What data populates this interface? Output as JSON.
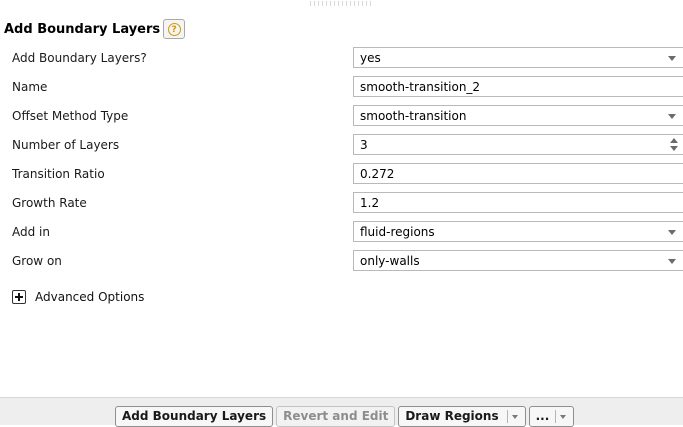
{
  "panel": {
    "title": "Add Boundary Layers",
    "help_glyph": "?"
  },
  "form": {
    "add_boundary_layers": {
      "label": "Add Boundary Layers?",
      "value": "yes"
    },
    "name": {
      "label": "Name",
      "value": "smooth-transition_2"
    },
    "offset_method": {
      "label": "Offset Method Type",
      "value": "smooth-transition"
    },
    "num_layers": {
      "label": "Number of Layers",
      "value": "3"
    },
    "transition_ratio": {
      "label": "Transition Ratio",
      "value": "0.272"
    },
    "growth_rate": {
      "label": "Growth Rate",
      "value": "1.2"
    },
    "add_in": {
      "label": "Add in",
      "value": "fluid-regions"
    },
    "grow_on": {
      "label": "Grow on",
      "value": "only-walls"
    }
  },
  "advanced": {
    "label": "Advanced Options"
  },
  "footer": {
    "add_button": "Add Boundary Layers",
    "revert_button": "Revert and Edit",
    "draw_regions_button": "Draw Regions",
    "more_button": "..."
  },
  "icons": {
    "help": "help-icon",
    "dropdown": "chevron-down-icon",
    "spinner": "spinner-icon",
    "expand": "plus-icon"
  },
  "colors": {
    "help_accent": "#d49a00",
    "footer_bg": "#eeeeee",
    "disabled_text": "#8d8d8d"
  }
}
